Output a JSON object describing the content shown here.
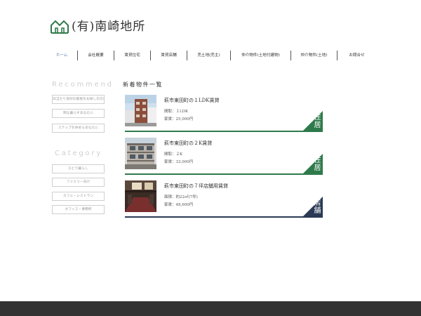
{
  "site": {
    "name": "(有)南崎地所"
  },
  "nav": {
    "items": [
      {
        "label": "ホーム",
        "active": true
      },
      {
        "label": "会社概要",
        "active": false
      },
      {
        "label": "賃貸住宅",
        "active": false
      },
      {
        "label": "賃貸店舗",
        "active": false
      },
      {
        "label": "売土地(売主)",
        "active": false
      },
      {
        "label": "仲介物件(土地付建物)",
        "active": false
      },
      {
        "label": "仲介物件(土地)",
        "active": false
      },
      {
        "label": "お問合せ",
        "active": false
      }
    ]
  },
  "sidebar": {
    "recommend_heading": "Recommend",
    "recommend_items": [
      "日当たり良好の部屋をお探しの方に",
      "閑な暮らすあなたに",
      "ステップを休めるあなたに"
    ],
    "category_heading": "Category",
    "category_items": [
      "ひとり暮らし",
      "ファミリー向け",
      "カフェ・レストラン",
      "オフィス・事務所"
    ]
  },
  "main": {
    "section_title": "新着物件一覧",
    "listings": [
      {
        "title": "萩市東田町の１LDK賃貸",
        "line1": "間取：１LDK",
        "line2": "家賃：25,000円",
        "tag": "住居",
        "tag_color": "#2f7a4b"
      },
      {
        "title": "萩市東田町の２K賃貸",
        "line1": "間取：２K",
        "line2": "家賃：33,000円",
        "tag": "住居",
        "tag_color": "#2f7a4b"
      },
      {
        "title": "萩市東田町の７坪店舗用賃貸",
        "line1": "面積：約22㎡(7坪)",
        "line2": "家賃：48,600円",
        "tag": "店舗",
        "tag_color": "#2b3a55"
      }
    ]
  },
  "colors": {
    "accent_green": "#2f7a4b",
    "accent_navy": "#2b3a55",
    "footer": "#333333"
  }
}
